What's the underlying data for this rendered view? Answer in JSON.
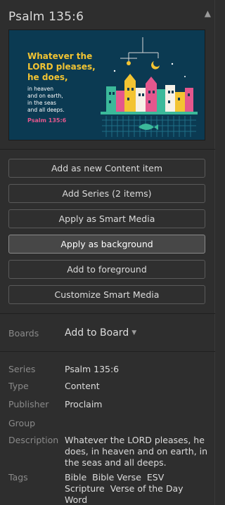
{
  "header": {
    "title": "Psalm 135:6",
    "collapse_icon": "▲"
  },
  "thumbnail": {
    "line1": "Whatever the",
    "line2": "LORD pleases,",
    "line3": "he does,",
    "body1": "in heaven",
    "body2": "and on earth,",
    "body3": "in the seas",
    "body4": "and all deeps.",
    "ref": "Psalm 135:6",
    "colors": {
      "background": "#0b3a52",
      "headline": "#f3c432",
      "body": "#ffffff",
      "ref": "#e4578d"
    }
  },
  "actions": {
    "add_content": "Add as new Content item",
    "add_series": "Add Series (2 items)",
    "apply_smart": "Apply as Smart Media",
    "apply_background": "Apply as background",
    "add_foreground": "Add to foreground",
    "customize_smart": "Customize Smart Media"
  },
  "boards": {
    "label": "Boards",
    "dropdown": "Add to Board",
    "caret": "▼"
  },
  "metadata": {
    "series": {
      "key": "Series",
      "value": "Psalm 135:6"
    },
    "type": {
      "key": "Type",
      "value": "Content"
    },
    "publisher": {
      "key": "Publisher",
      "value": "Proclaim"
    },
    "group": {
      "key": "Group",
      "value": ""
    },
    "description": {
      "key": "Description",
      "value": "Whatever the LORD pleases, he does, in heaven and on earth, in the seas and all deeps."
    },
    "tags": {
      "key": "Tags",
      "items": [
        "Bible",
        "Bible Verse",
        "ESV",
        "Scripture",
        "Verse of the Day",
        "Word"
      ]
    }
  }
}
